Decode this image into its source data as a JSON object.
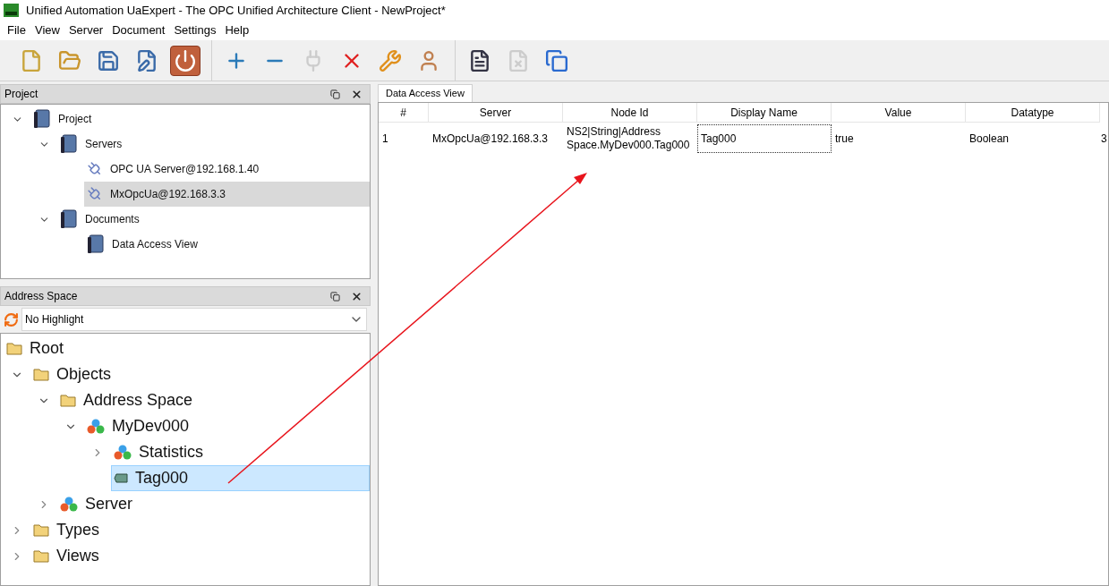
{
  "window": {
    "title": "Unified Automation UaExpert - The OPC Unified Architecture Client - NewProject*"
  },
  "menu": [
    {
      "label": "File"
    },
    {
      "label": "View"
    },
    {
      "label": "Server"
    },
    {
      "label": "Document"
    },
    {
      "label": "Settings"
    },
    {
      "label": "Help"
    }
  ],
  "toolbar": [
    [
      {
        "kind": "new",
        "disabled": false
      },
      {
        "kind": "open",
        "disabled": false
      },
      {
        "kind": "save",
        "disabled": false
      },
      {
        "kind": "edit",
        "disabled": false
      },
      {
        "kind": "power",
        "disabled": false
      }
    ],
    [
      {
        "kind": "add",
        "disabled": false
      },
      {
        "kind": "remove",
        "disabled": false
      },
      {
        "kind": "connect",
        "disabled": true
      },
      {
        "kind": "disconnect",
        "disabled": false
      },
      {
        "kind": "wrench",
        "disabled": false
      },
      {
        "kind": "user",
        "disabled": false
      }
    ],
    [
      {
        "kind": "document",
        "disabled": false
      },
      {
        "kind": "close-document",
        "disabled": true
      },
      {
        "kind": "windows",
        "disabled": false
      }
    ]
  ],
  "project_panel": {
    "title": "Project",
    "tree": [
      {
        "label": "Project",
        "kind": "book",
        "expanded": true,
        "selected": false,
        "children": [
          {
            "label": "Servers",
            "kind": "book",
            "expanded": true,
            "selected": false,
            "children": [
              {
                "label": "OPC UA Server@192.168.1.40",
                "kind": "plug",
                "selected": false
              },
              {
                "label": "MxOpcUa@192.168.3.3",
                "kind": "plug",
                "selected": true
              }
            ]
          },
          {
            "label": "Documents",
            "kind": "book",
            "expanded": true,
            "selected": false,
            "children": [
              {
                "label": "Data Access View",
                "kind": "book",
                "selected": false
              }
            ]
          }
        ]
      }
    ]
  },
  "address_space_panel": {
    "title": "Address Space",
    "highlight": "No Highlight",
    "tree": [
      {
        "label": "Root",
        "kind": "folder",
        "selected": false,
        "children": [
          {
            "label": "Objects",
            "kind": "folder",
            "expanded": true,
            "selected": false,
            "children": [
              {
                "label": "Address Space",
                "kind": "folder",
                "expanded": true,
                "selected": false,
                "children": [
                  {
                    "label": "MyDev000",
                    "kind": "object",
                    "expanded": true,
                    "selected": false,
                    "children": [
                      {
                        "label": "Statistics",
                        "kind": "object",
                        "expanded": false,
                        "selected": false
                      },
                      {
                        "label": "Tag000",
                        "kind": "tag",
                        "selected": true
                      }
                    ]
                  }
                ]
              },
              {
                "label": "Server",
                "kind": "object",
                "expanded": false,
                "selected": false
              }
            ]
          },
          {
            "label": "Types",
            "kind": "folder",
            "expanded": false,
            "selected": false
          },
          {
            "label": "Views",
            "kind": "folder",
            "expanded": false,
            "selected": false
          }
        ]
      }
    ]
  },
  "document_tabs": [
    {
      "label": "Data Access View",
      "selected": true
    }
  ],
  "table": {
    "columns": [
      "#",
      "Server",
      "Node Id",
      "Display Name",
      "Value",
      "Datatype"
    ],
    "rows": [
      {
        "cells": [
          {
            "text": "1",
            "focused": false
          },
          {
            "text": "MxOpcUa@192.168.3.3",
            "focused": false
          },
          {
            "text": "NS2|String|Address Space.MyDev000.Tag000",
            "focused": false
          },
          {
            "text": "Tag000",
            "focused": true
          },
          {
            "text": "true",
            "focused": false
          },
          {
            "text": "Boolean",
            "focused": false
          },
          {
            "text": "3",
            "focused": false
          }
        ]
      }
    ]
  }
}
